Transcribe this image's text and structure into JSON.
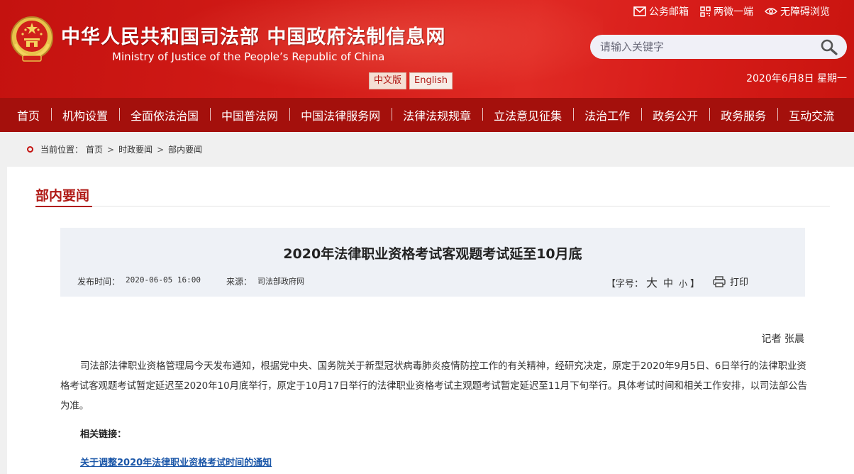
{
  "header": {
    "title_cn": "中华人民共和国司法部  中国政府法制信息网",
    "title_en": "Ministry of Justice of the People’s Republic of China",
    "lang": [
      "中文版",
      "English"
    ],
    "top_links": [
      {
        "label": "公务邮箱",
        "icon": "mail-icon"
      },
      {
        "label": "两微一端",
        "icon": "qr-code-icon"
      },
      {
        "label": "无障碍浏览",
        "icon": "eye-icon"
      }
    ],
    "search_placeholder": "请输入关键字",
    "date": "2020年6月8日 星期一"
  },
  "nav": [
    "首页",
    "机构设置",
    "全面依法治国",
    "中国普法网",
    "中国法律服务网",
    "法律法规规章",
    "立法意见征集",
    "法治工作",
    "政务公开",
    "政务服务",
    "互动交流"
  ],
  "breadcrumb": {
    "prefix": "当前位置：",
    "items": [
      "首页",
      "时政要闻",
      "部内要闻"
    ],
    "sep": ">"
  },
  "section": {
    "title": "部内要闻"
  },
  "article": {
    "title": "2020年法律职业资格考试客观题考试延至10月底",
    "publish_label": "发布时间：",
    "publish_time": "2020-06-05 16:00",
    "source_label": "来源：",
    "source": "司法部政府网",
    "fontsize_label": "【字号：",
    "fontsize_options": [
      "大",
      "中",
      "小"
    ],
    "fontsize_close": "】",
    "print_label": "打印",
    "reporter": "记者 张晨",
    "body": "司法部法律职业资格管理局今天发布通知，根据党中央、国务院关于新型冠状病毒肺炎疫情防控工作的有关精神，经研究决定，原定于2020年9月5日、6日举行的法律职业资格考试客观题考试暂定延迟至2020年10月底举行，原定于10月17日举行的法律职业资格考试主观题考试暂定延迟至11月下旬举行。具体考试时间和相关工作安排，以司法部公告为准。",
    "related_label": "相关链接：",
    "related_link": "关于调整2020年法律职业资格考试时间的通知"
  }
}
